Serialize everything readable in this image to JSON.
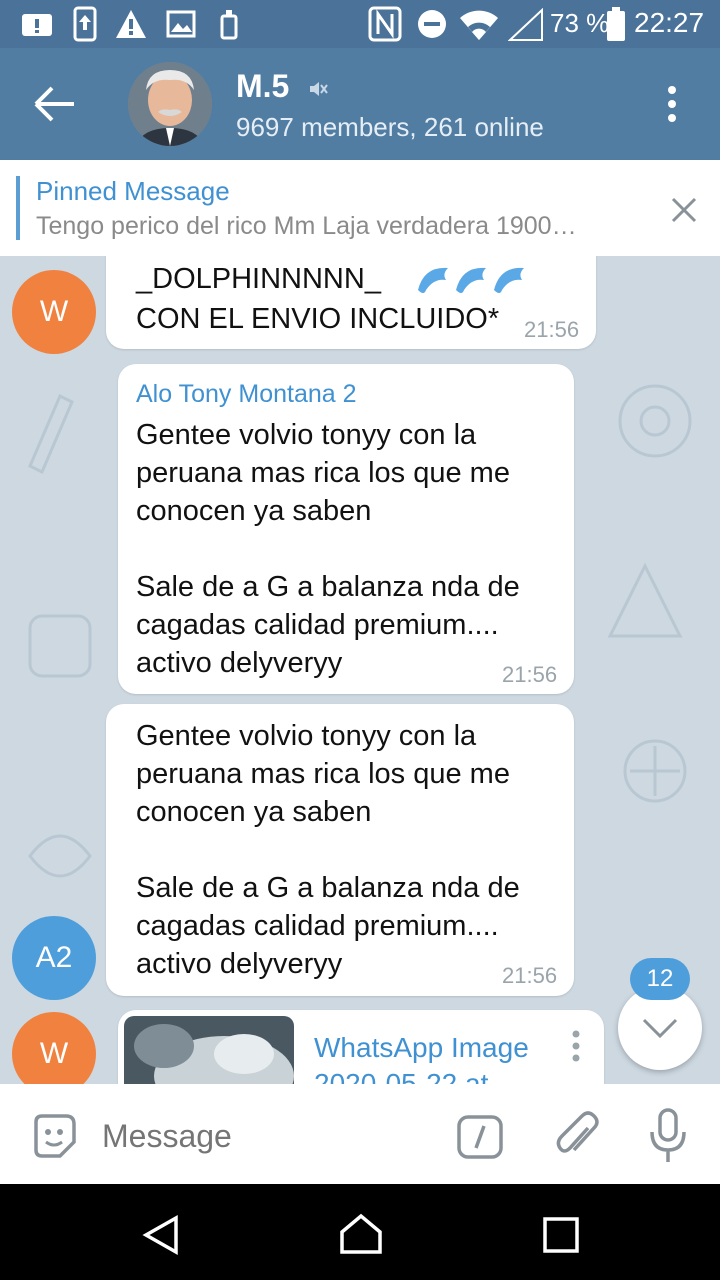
{
  "status_bar": {
    "battery": "73 %",
    "time": "22:27"
  },
  "header": {
    "title": "M.5",
    "subtitle": "9697 members, 261 online"
  },
  "pinned": {
    "title": "Pinned Message",
    "text": "Tengo perico del rico Mm Laja verdadera  1900…"
  },
  "messages": [
    {
      "avatar": "W",
      "line1": "_DOLPHINNNNN_ ",
      "line2": "CON EL ENVIO INCLUIDO*",
      "time": "21:56"
    },
    {
      "sender": "Alo Tony Montana 2",
      "text": "Gentee volvio tonyy con la\nperuana mas rica los que me\nconocen ya saben\n\nSale de a G a balanza nda de\ncagadas calidad premium....\nactivo delyveryy",
      "time": "21:56"
    },
    {
      "avatar": "A2",
      "text": "Gentee volvio tonyy con la\nperuana mas rica los que me\nconocen ya saben\n\nSale de a G a balanza nda de\ncagadas calidad premium....\nactivo delyveryy",
      "time": "21:56"
    },
    {
      "avatar": "W",
      "file_title": "WhatsApp Image",
      "file_sub": "2020-05-22 at"
    }
  ],
  "scroll_badge": "12",
  "input": {
    "placeholder": "Message"
  },
  "colors": {
    "header": "#527da3",
    "statusbar": "#4b7299",
    "accent": "#3f91d2",
    "avatar_orange": "#f0813f",
    "avatar_blue": "#4e9edb"
  }
}
